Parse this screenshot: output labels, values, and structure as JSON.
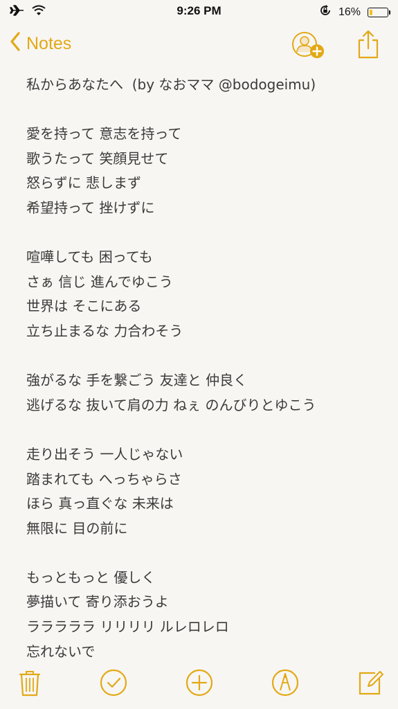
{
  "status_bar": {
    "time": "9:26 PM",
    "battery_percent": "16%",
    "battery_level": 0.16,
    "left_icons": [
      "airplane-icon",
      "wifi-icon"
    ],
    "right_icons": [
      "orientation-lock-icon",
      "battery-icon"
    ]
  },
  "nav": {
    "back_label": "Notes",
    "icons": [
      "add-people-icon",
      "share-icon"
    ]
  },
  "accent_color": "#e3a815",
  "note": {
    "lines": [
      "私からあなたへ  (by なおママ @bodogeimu)",
      "",
      "愛を持って 意志を持って",
      "歌うたって 笑顔見せて",
      "怒らずに 悲しまず",
      "希望持って 挫けずに",
      "",
      "喧嘩しても 困っても",
      "さぁ 信じ 進んでゆこう",
      "世界は そこにある",
      "立ち止まるな 力合わそう",
      "",
      "強がるな 手を繋ごう 友達と 仲良く",
      "逃げるな 抜いて肩の力 ねぇ のんびりとゆこう",
      "",
      "走り出そう 一人じゃない",
      "踏まれても へっちゃらさ",
      "ほら 真っ直ぐな 未来は",
      "無限に 目の前に",
      "",
      "もっともっと 優しく",
      "夢描いて 寄り添おうよ",
      "ラララララ リリリリ ルレロレロ",
      "忘れないで"
    ]
  },
  "toolbar": {
    "icons": [
      "trash-icon",
      "checklist-icon",
      "add-icon",
      "sketch-icon",
      "compose-icon"
    ]
  }
}
